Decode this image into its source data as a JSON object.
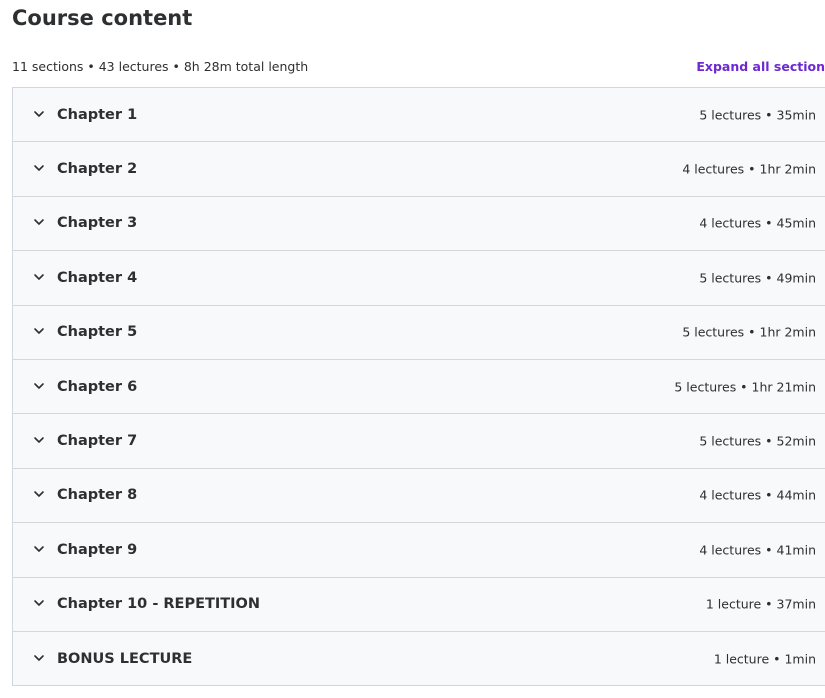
{
  "header": {
    "title": "Course content",
    "summary": "11 sections • 43 lectures • 8h 28m total length",
    "expand_label": "Expand all section"
  },
  "colors": {
    "accent": "#6d28d2",
    "row_background": "#f7f9fa",
    "border": "#d1d7dc",
    "text": "#2d2f31"
  },
  "sections": [
    {
      "title": "Chapter 1",
      "meta": "5 lectures • 35min",
      "icon": "chevron-down-icon"
    },
    {
      "title": "Chapter 2",
      "meta": "4 lectures • 1hr 2min",
      "icon": "chevron-down-icon"
    },
    {
      "title": "Chapter 3",
      "meta": "4 lectures • 45min",
      "icon": "chevron-down-icon"
    },
    {
      "title": "Chapter 4",
      "meta": "5 lectures • 49min",
      "icon": "chevron-down-icon"
    },
    {
      "title": "Chapter 5",
      "meta": "5 lectures • 1hr 2min",
      "icon": "chevron-down-icon"
    },
    {
      "title": "Chapter 6",
      "meta": "5 lectures • 1hr 21min",
      "icon": "chevron-down-icon"
    },
    {
      "title": "Chapter 7",
      "meta": "5 lectures • 52min",
      "icon": "chevron-down-icon"
    },
    {
      "title": "Chapter 8",
      "meta": "4 lectures • 44min",
      "icon": "chevron-down-icon"
    },
    {
      "title": "Chapter 9",
      "meta": "4 lectures • 41min",
      "icon": "chevron-down-icon"
    },
    {
      "title": "Chapter 10 - REPETITION",
      "meta": "1 lecture • 37min",
      "icon": "chevron-down-icon"
    },
    {
      "title": "BONUS LECTURE",
      "meta": "1 lecture • 1min",
      "icon": "chevron-down-icon"
    }
  ]
}
